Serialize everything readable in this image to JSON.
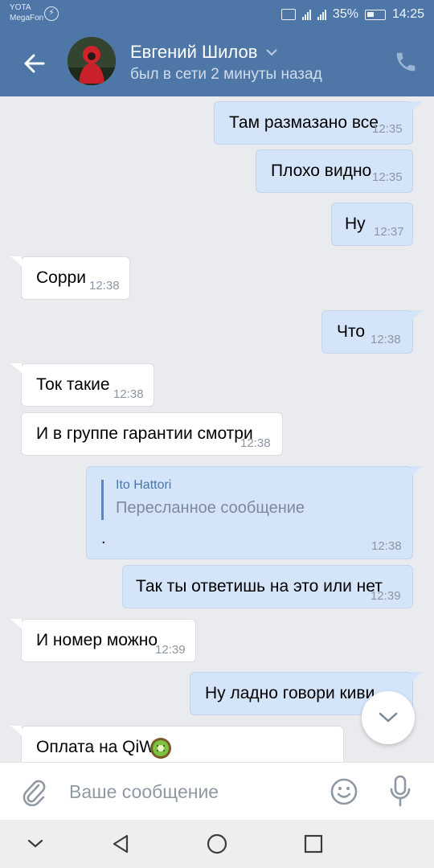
{
  "status_bar": {
    "carrier1": "YOTA",
    "carrier2": "MegaFon",
    "battery": "35%",
    "time": "14:25"
  },
  "header": {
    "contact_name": "Евгений Шилов",
    "last_seen": "был в сети 2 минуты назад"
  },
  "messages": [
    {
      "text": "Там размазано все",
      "time": "12:35"
    },
    {
      "text": "Плохо видно",
      "time": "12:35"
    },
    {
      "text": "Ну",
      "time": "12:37"
    },
    {
      "text": "Сорри",
      "time": "12:38"
    },
    {
      "text": "Что",
      "time": "12:38"
    },
    {
      "text": "Ток такие",
      "time": "12:38"
    },
    {
      "text": "И в группе гарантии смотри",
      "time": "12:38"
    },
    {
      "forward_author": "Ito Hattori",
      "forward_label": "Пересланное сообщение",
      "text": ".",
      "time": "12:38"
    },
    {
      "text": "Так ты ответишь на это или нет",
      "time": "12:39"
    },
    {
      "text": "И номер можно",
      "time": "12:39"
    },
    {
      "text": "Ну ладно говори киви",
      "time": ""
    },
    {
      "text": "Оплата на QiWi",
      "time": ""
    }
  ],
  "composer": {
    "placeholder": "Ваше сообщение"
  },
  "colors": {
    "header_blue": "#4e77a8",
    "outgoing_bubble": "#d5e5f9",
    "incoming_bubble": "#ffffff",
    "background": "#e9ebee"
  },
  "icons": [
    "back-arrow-icon",
    "chevron-down-icon",
    "phone-icon",
    "paperclip-icon",
    "smiley-icon",
    "microphone-icon",
    "kiwi-emoji-icon",
    "nav-back-icon",
    "nav-home-icon",
    "nav-recents-icon",
    "nav-hide-icon"
  ]
}
